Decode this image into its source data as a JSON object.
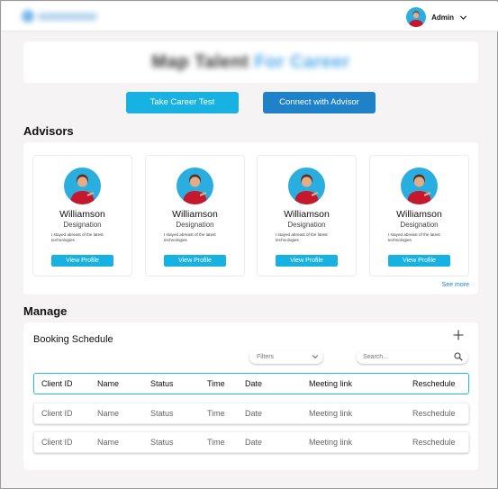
{
  "header": {
    "admin_label": "Admin"
  },
  "hero": {
    "title_part1": "Map Talent",
    "title_part2": "For Career"
  },
  "actions": {
    "take_test": "Take Career Test",
    "connect_advisor": "Connect with Advisor"
  },
  "advisors": {
    "title": "Advisors",
    "see_more": "See more",
    "cards": [
      {
        "name": "Williamson",
        "designation": "Designation",
        "blurb": "I stayed abreast of the latest technologies",
        "button": "View Profile"
      },
      {
        "name": "Williamson",
        "designation": "Designation",
        "blurb": "I stayed abreast of the latest technologies",
        "button": "View Profile"
      },
      {
        "name": "Williamson",
        "designation": "Designation",
        "blurb": "I stayed abreast of the latest technologies",
        "button": "View Profile"
      },
      {
        "name": "Williamson",
        "designation": "Designation",
        "blurb": "I stayed abreast of the latest technologies",
        "button": "View Profile"
      }
    ]
  },
  "manage": {
    "title": "Manage",
    "booking_title": "Booking Schedule",
    "filters_label": "Filters",
    "search_placeholder": "Search...",
    "columns": [
      "Client ID",
      "Name",
      "Status",
      "Time",
      "Date",
      "Meeting link",
      "Reschedule"
    ],
    "rows": [
      [
        "Client ID",
        "Name",
        "Status",
        "Time",
        "Date",
        "Meeting link",
        "Reschedule"
      ],
      [
        "Client ID",
        "Name",
        "Status",
        "Time",
        "Date",
        "Meeting link",
        "Reschedule"
      ]
    ]
  },
  "icons": {
    "dropdown": "chevron-down-icon",
    "add": "plus-icon",
    "search": "search-icon"
  },
  "colors": {
    "primary_cyan": "#17b2e2",
    "primary_blue": "#1f82c9",
    "background": "#f5f3f3",
    "header_row_border": "#23b6e0"
  }
}
